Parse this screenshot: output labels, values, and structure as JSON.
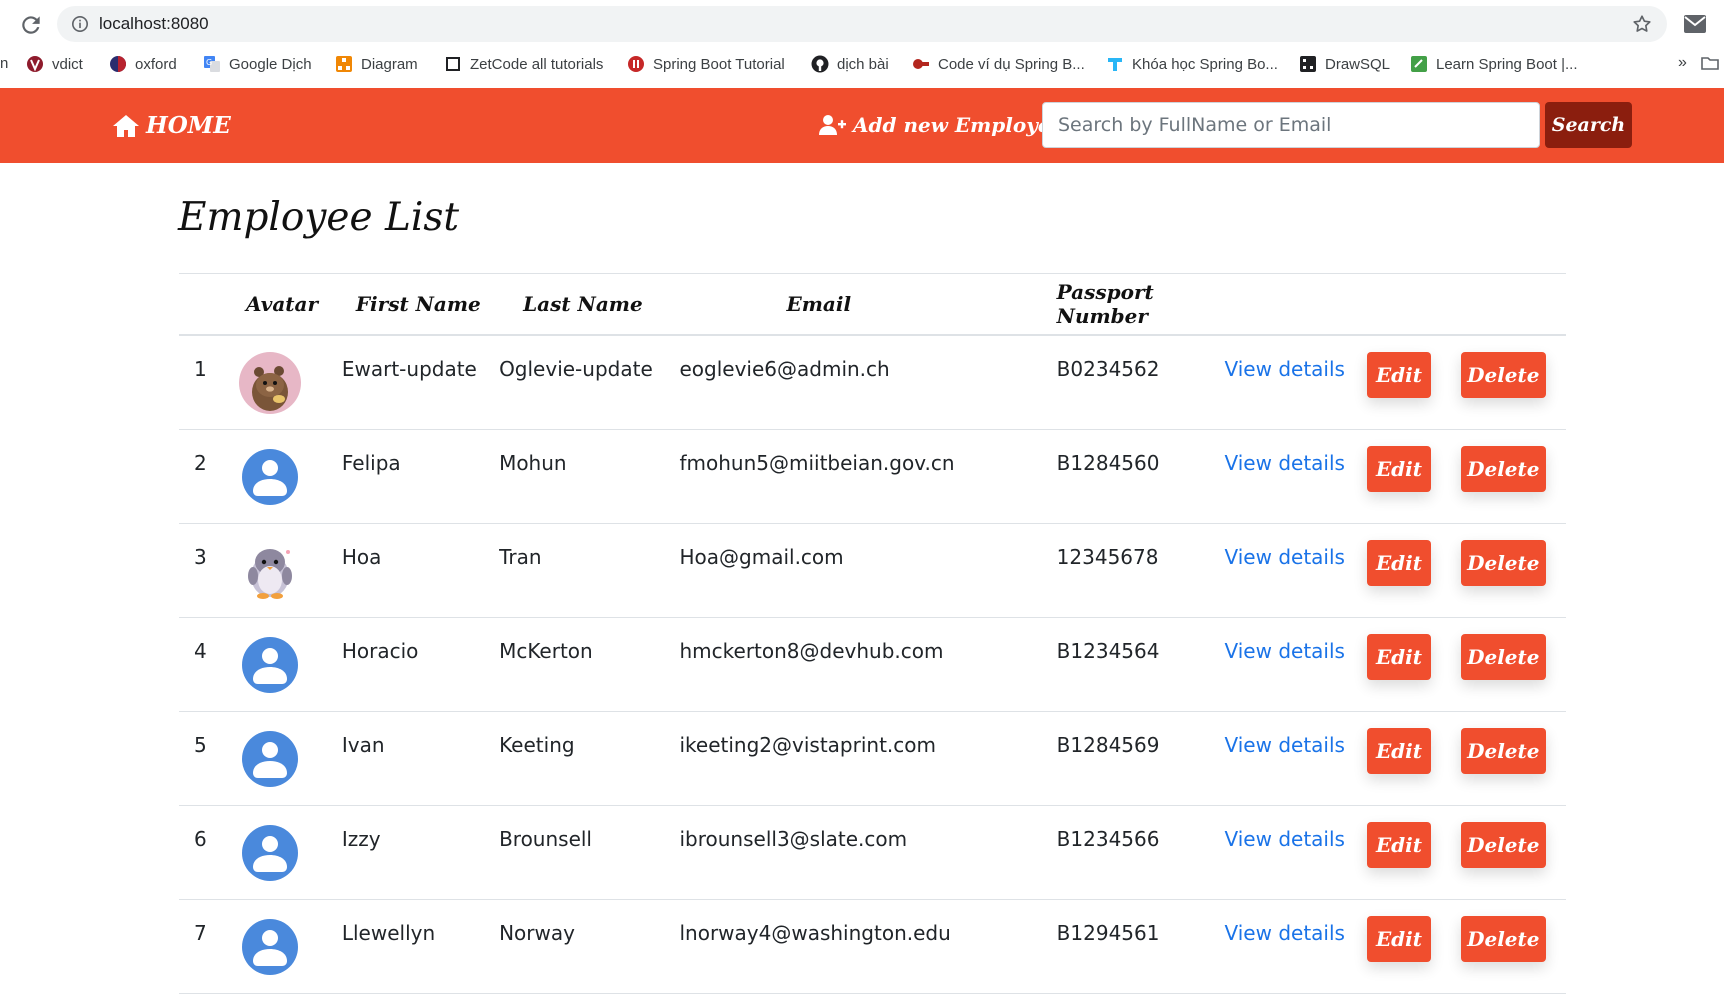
{
  "browser": {
    "url": "localhost:8080",
    "bookmark_edge_text": "n",
    "bookmarks_more": "»",
    "bookmarks": [
      {
        "label": "vdict",
        "icon": "vdict-icon"
      },
      {
        "label": "oxford",
        "icon": "oxford-icon"
      },
      {
        "label": "Google Dịch",
        "icon": "google-translate-icon"
      },
      {
        "label": "Diagram",
        "icon": "diagram-icon"
      },
      {
        "label": "ZetCode all tutorials",
        "icon": "zetcode-icon"
      },
      {
        "label": "Spring Boot Tutorial",
        "icon": "spring-tutorial-icon"
      },
      {
        "label": "dịch bài",
        "icon": "github-icon"
      },
      {
        "label": "Code ví dụ Spring B...",
        "icon": "gpcoder-icon"
      },
      {
        "label": "Khóa học Spring Bo...",
        "icon": "course-icon"
      },
      {
        "label": "DrawSQL",
        "icon": "drawsql-icon"
      },
      {
        "label": "Learn Spring Boot |...",
        "icon": "learn-icon"
      }
    ]
  },
  "navbar": {
    "home_label": "HOME",
    "add_label": "Add new Employee",
    "search_placeholder": "Search by FullName or Email",
    "search_button": "Search",
    "accent_color": "#f04e2e",
    "search_button_color": "#8b1e0e"
  },
  "page": {
    "title": "Employee List"
  },
  "table": {
    "headers": {
      "index": "",
      "avatar": "Avatar",
      "first_name": "First Name",
      "last_name": "Last Name",
      "email": "Email",
      "passport": "Passport Number"
    },
    "view_label": "View details",
    "edit_label": "Edit",
    "delete_label": "Delete",
    "rows": [
      {
        "index": "1",
        "avatar": "bear-avatar",
        "first_name": "Ewart-update",
        "last_name": "Oglevie-update",
        "email": "eoglevie6@admin.ch",
        "passport": "B0234562"
      },
      {
        "index": "2",
        "avatar": "default-avatar",
        "first_name": "Felipa",
        "last_name": "Mohun",
        "email": "fmohun5@miitbeian.gov.cn",
        "passport": "B1284560"
      },
      {
        "index": "3",
        "avatar": "penguin-avatar",
        "first_name": "Hoa",
        "last_name": "Tran",
        "email": "Hoa@gmail.com",
        "passport": "12345678"
      },
      {
        "index": "4",
        "avatar": "default-avatar",
        "first_name": "Horacio",
        "last_name": "McKerton",
        "email": "hmckerton8@devhub.com",
        "passport": "B1234564"
      },
      {
        "index": "5",
        "avatar": "default-avatar",
        "first_name": "Ivan",
        "last_name": "Keeting",
        "email": "ikeeting2@vistaprint.com",
        "passport": "B1284569"
      },
      {
        "index": "6",
        "avatar": "default-avatar",
        "first_name": "Izzy",
        "last_name": "Brounsell",
        "email": "ibrounsell3@slate.com",
        "passport": "B1234566"
      },
      {
        "index": "7",
        "avatar": "default-avatar",
        "first_name": "Llewellyn",
        "last_name": "Norway",
        "email": "lnorway4@washington.edu",
        "passport": "B1294561"
      }
    ]
  }
}
